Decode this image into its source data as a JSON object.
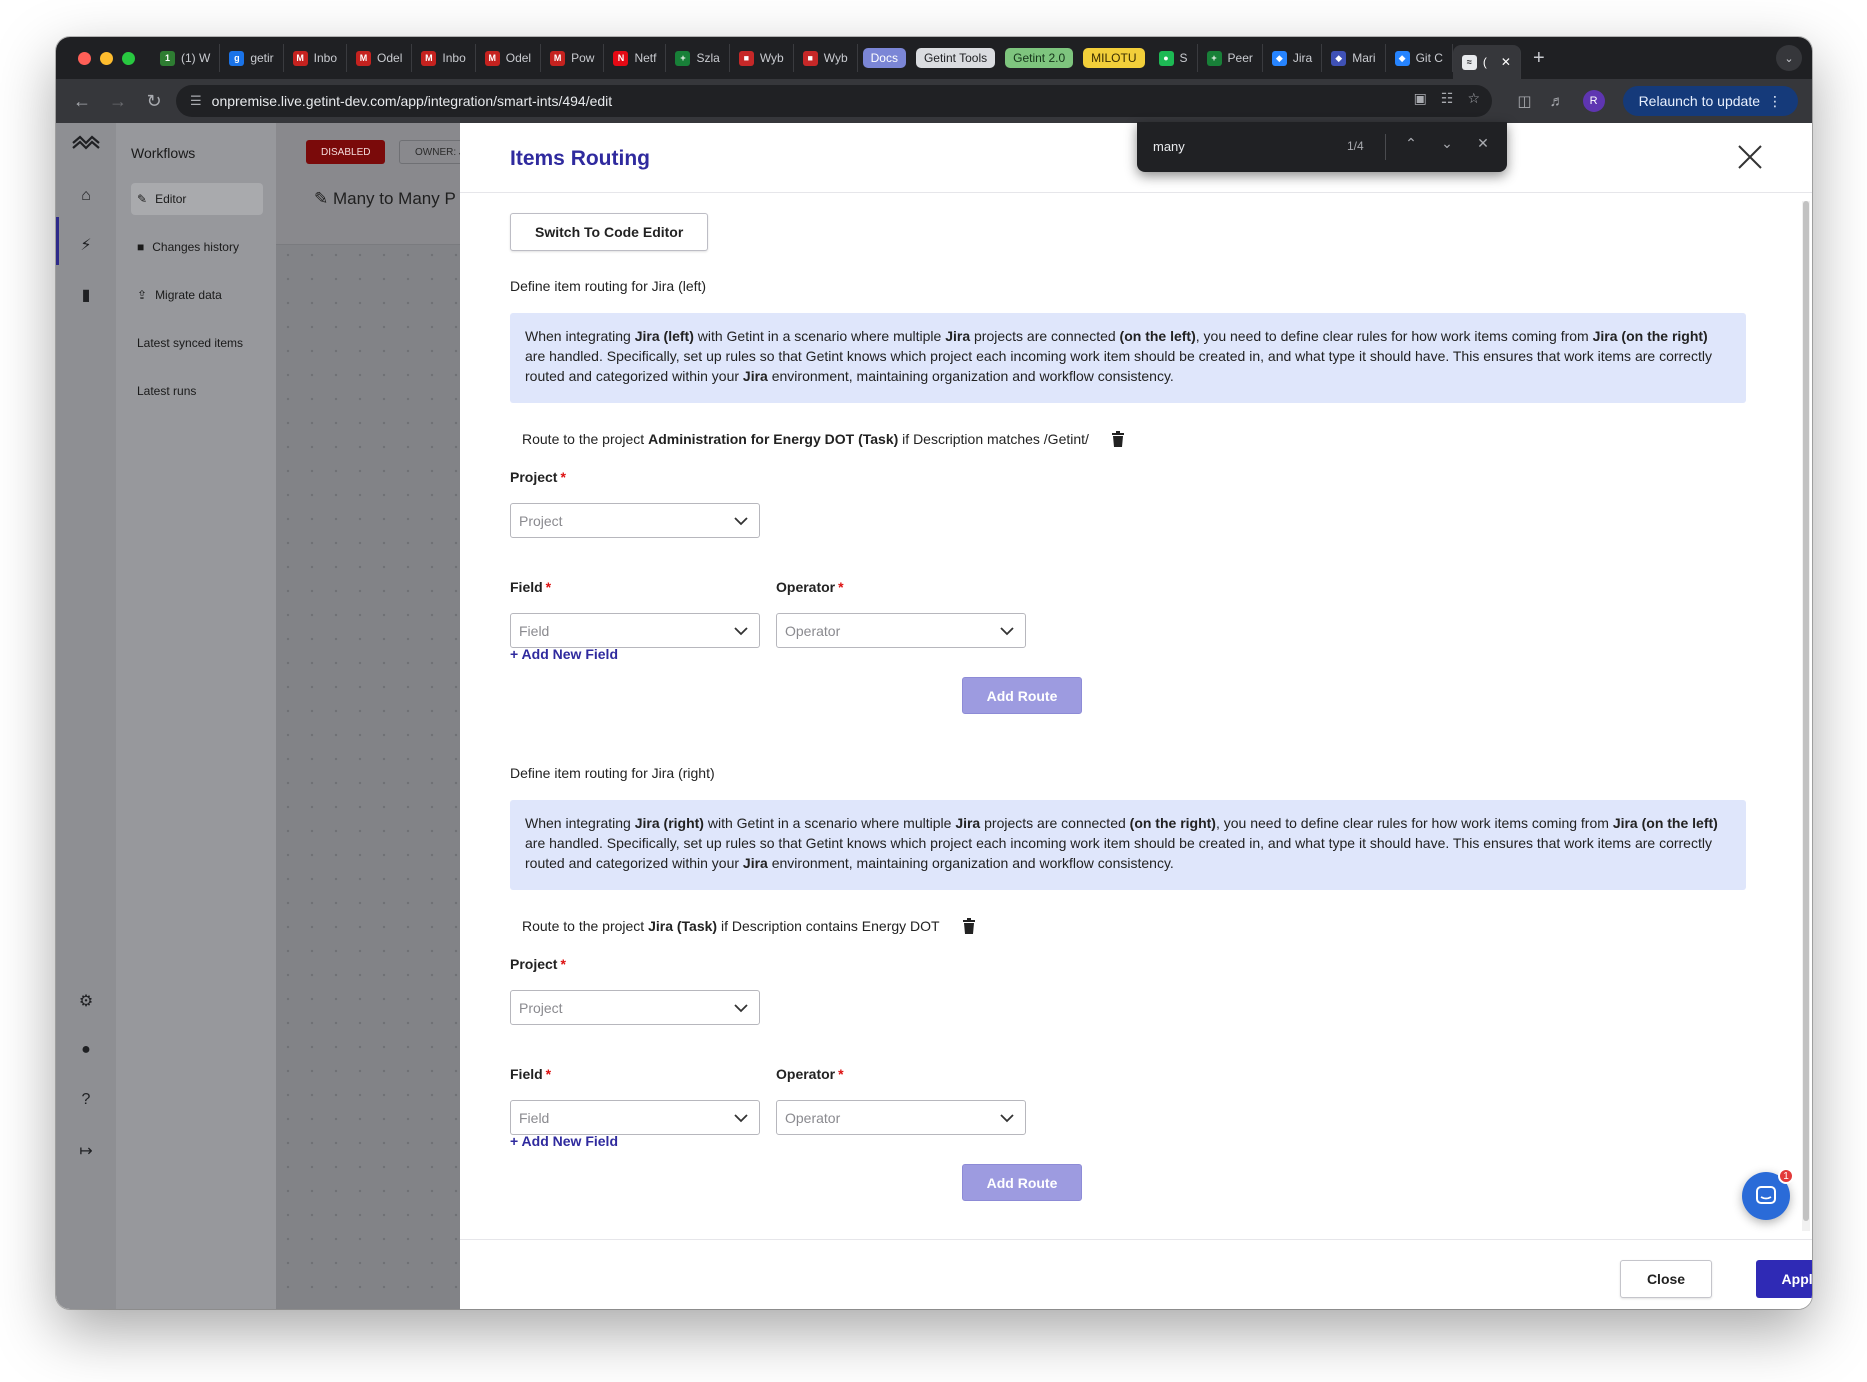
{
  "browser": {
    "tabs": [
      {
        "label": "(1) W",
        "fav": "1",
        "color": "#2e7d32"
      },
      {
        "label": "getir",
        "fav": "g",
        "color": "#1a73e8"
      },
      {
        "label": "Inbo",
        "fav": "M",
        "color": "#c5221f"
      },
      {
        "label": "Odel",
        "fav": "M",
        "color": "#c5221f"
      },
      {
        "label": "Inbo",
        "fav": "M",
        "color": "#c5221f"
      },
      {
        "label": "Odel",
        "fav": "M",
        "color": "#c5221f"
      },
      {
        "label": "Pow",
        "fav": "M",
        "color": "#c5221f"
      },
      {
        "label": "Netf",
        "fav": "N",
        "color": "#e50914"
      },
      {
        "label": "Szla",
        "fav": "+",
        "color": "#188038"
      },
      {
        "label": "Wyb",
        "fav": "■",
        "color": "#c62828"
      },
      {
        "label": "Wyb",
        "fav": "■",
        "color": "#c62828"
      }
    ],
    "pills": [
      {
        "label": "Docs",
        "bg": "#7b86d6",
        "fg": "#ffffff"
      },
      {
        "label": "Getint Tools",
        "bg": "#dadce0",
        "fg": "#202124"
      },
      {
        "label": "Getint 2.0",
        "bg": "#7ec57e",
        "fg": "#15351a"
      },
      {
        "label": "MILOTU",
        "bg": "#f2cf3a",
        "fg": "#3a2d00"
      }
    ],
    "tabs_after": [
      {
        "label": "S",
        "fav": "●",
        "color": "#1db954"
      },
      {
        "label": "Peer",
        "fav": "+",
        "color": "#188038"
      },
      {
        "label": "Jira",
        "fav": "◆",
        "color": "#2684ff"
      },
      {
        "label": "Mari",
        "fav": "◆",
        "color": "#3f51b5"
      },
      {
        "label": "Git C",
        "fav": "◆",
        "color": "#2684ff"
      }
    ],
    "active_tab": {
      "label": "(",
      "fav": "≈"
    },
    "url": "onpremise.live.getint-dev.com/app/integration/smart-ints/494/edit",
    "avatar_letter": "R",
    "relaunch_label": "Relaunch to update"
  },
  "findbar": {
    "query": "many",
    "count": "1/4"
  },
  "sidebar": {
    "title": "Workflows",
    "items": [
      {
        "label": "Editor",
        "icon": "pencil-icon"
      },
      {
        "label": "Changes history",
        "icon": "folder-icon"
      },
      {
        "label": "Migrate data",
        "icon": "upload-icon"
      },
      {
        "label": "Latest synced items",
        "icon": ""
      },
      {
        "label": "Latest runs",
        "icon": ""
      }
    ]
  },
  "canvas": {
    "status_badge": "DISABLED",
    "owner_badge": "OWNER: J",
    "workflow_name": "Many to Many P"
  },
  "modal": {
    "title": "Items Routing",
    "switch_button": "Switch To Code Editor",
    "left": {
      "section_title": "Define item routing for Jira (left)",
      "info_html_parts": {
        "p1": "When integrating ",
        "b1": "Jira (left)",
        "p2": " with Getint in a scenario where multiple ",
        "b2": "Jira",
        "p3": " projects are connected ",
        "b3": "(on the left)",
        "p4": ", you need to define clear rules for how work items coming from ",
        "b4": "Jira (on the right)",
        "p5": " are handled. Specifically, set up rules so that Getint knows which project each incoming work item should be created in, and what type it should have. This ensures that work items are correctly routed and categorized within your ",
        "b5": "Jira",
        "p6": " environment, maintaining organization and workflow consistency."
      },
      "route_prefix": "Route to the project ",
      "route_project": "Administration for Energy DOT (Task)",
      "route_suffix": " if Description matches /Getint/",
      "project_label": "Project",
      "project_placeholder": "Project",
      "field_label": "Field",
      "field_placeholder": "Field",
      "operator_label": "Operator",
      "operator_placeholder": "Operator",
      "add_field": "+ Add New Field",
      "add_route": "Add Route"
    },
    "right": {
      "section_title": "Define item routing for Jira (right)",
      "info_html_parts": {
        "p1": "When integrating ",
        "b1": "Jira (right)",
        "p2": " with Getint in a scenario where multiple ",
        "b2": "Jira",
        "p3": " projects are connected ",
        "b3": "(on the right)",
        "p4": ", you need to define clear rules for how work items coming from ",
        "b4": "Jira (on the left)",
        "p5": " are handled. Specifically, set up rules so that Getint knows which project each incoming work item should be created in, and what type it should have. This ensures that work items are correctly routed and categorized within your ",
        "b5": "Jira",
        "p6": " environment, maintaining organization and workflow consistency."
      },
      "route_prefix": "Route to the project ",
      "route_project": "Jira (Task)",
      "route_suffix": " if Description contains Energy DOT",
      "project_label": "Project",
      "project_placeholder": "Project",
      "field_label": "Field",
      "field_placeholder": "Field",
      "operator_label": "Operator",
      "operator_placeholder": "Operator",
      "add_field": "+ Add New Field",
      "add_route": "Add Route"
    },
    "close_button": "Close",
    "apply_button": "Apply"
  },
  "chat": {
    "badge": "1"
  },
  "colors": {
    "accent": "#2f2ab5",
    "title": "#2f2a9e",
    "info_bg": "#dfe6fb",
    "disabled": "#7a0a0a"
  }
}
